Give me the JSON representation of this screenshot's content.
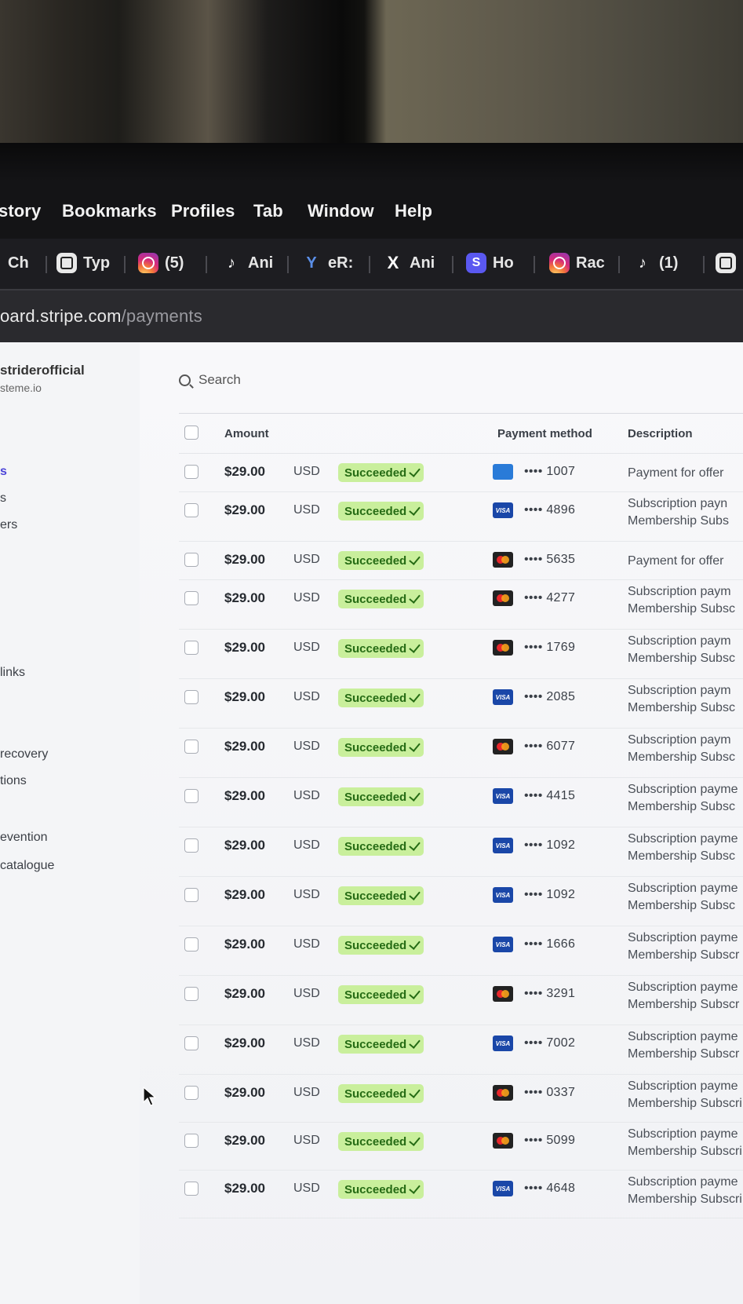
{
  "menubar": {
    "items": [
      "story",
      "Bookmarks",
      "Profiles",
      "Tab",
      "Window",
      "Help"
    ]
  },
  "tabs": [
    {
      "title": "Ch",
      "icon": "none"
    },
    {
      "title": "Typ",
      "icon": "square-app-icon"
    },
    {
      "title": "(5)",
      "icon": "instagram-icon"
    },
    {
      "title": "Ani",
      "icon": "tiktok-icon"
    },
    {
      "title": "eR:",
      "icon": "y-logo-icon"
    },
    {
      "title": "Ani",
      "icon": "x-logo-icon"
    },
    {
      "title": "Ho",
      "icon": "s-logo-icon"
    },
    {
      "title": "Rac",
      "icon": "instagram-icon"
    },
    {
      "title": "(1)",
      "icon": "tiktok-icon"
    }
  ],
  "address": {
    "host": "oard.stripe.com",
    "path": "/payments"
  },
  "sidebar": {
    "account_name": "striderofficial",
    "account_sub": "steme.io",
    "items": [
      "s",
      "s",
      "ers",
      "links",
      "recovery",
      "tions",
      "evention",
      "catalogue"
    ]
  },
  "search": {
    "placeholder": "Search"
  },
  "table": {
    "headers": {
      "amount": "Amount",
      "payment_method": "Payment method",
      "description": "Description"
    },
    "rows": [
      {
        "amount": "$29.00",
        "currency": "USD",
        "status": "Succeeded",
        "brand": "amex",
        "last4": "•••• 1007",
        "desc1": "Payment for offer",
        "desc2": ""
      },
      {
        "amount": "$29.00",
        "currency": "USD",
        "status": "Succeeded",
        "brand": "visa",
        "last4": "•••• 4896",
        "desc1": "Subscription payn",
        "desc2": "Membership Subs"
      },
      {
        "amount": "$29.00",
        "currency": "USD",
        "status": "Succeeded",
        "brand": "mastercard",
        "last4": "•••• 5635",
        "desc1": "Payment for offer",
        "desc2": ""
      },
      {
        "amount": "$29.00",
        "currency": "USD",
        "status": "Succeeded",
        "brand": "mastercard",
        "last4": "•••• 4277",
        "desc1": "Subscription paym",
        "desc2": "Membership Subsc"
      },
      {
        "amount": "$29.00",
        "currency": "USD",
        "status": "Succeeded",
        "brand": "mastercard",
        "last4": "•••• 1769",
        "desc1": "Subscription paym",
        "desc2": "Membership Subsc"
      },
      {
        "amount": "$29.00",
        "currency": "USD",
        "status": "Succeeded",
        "brand": "visa",
        "last4": "•••• 2085",
        "desc1": "Subscription paym",
        "desc2": "Membership Subsc"
      },
      {
        "amount": "$29.00",
        "currency": "USD",
        "status": "Succeeded",
        "brand": "mastercard",
        "last4": "•••• 6077",
        "desc1": "Subscription paym",
        "desc2": "Membership Subsc"
      },
      {
        "amount": "$29.00",
        "currency": "USD",
        "status": "Succeeded",
        "brand": "visa",
        "last4": "•••• 4415",
        "desc1": "Subscription payme",
        "desc2": "Membership Subsc"
      },
      {
        "amount": "$29.00",
        "currency": "USD",
        "status": "Succeeded",
        "brand": "visa",
        "last4": "•••• 1092",
        "desc1": "Subscription payme",
        "desc2": "Membership Subsc"
      },
      {
        "amount": "$29.00",
        "currency": "USD",
        "status": "Succeeded",
        "brand": "visa",
        "last4": "•••• 1092",
        "desc1": "Subscription payme",
        "desc2": "Membership Subsc"
      },
      {
        "amount": "$29.00",
        "currency": "USD",
        "status": "Succeeded",
        "brand": "visa",
        "last4": "•••• 1666",
        "desc1": "Subscription payme",
        "desc2": "Membership Subscr"
      },
      {
        "amount": "$29.00",
        "currency": "USD",
        "status": "Succeeded",
        "brand": "mastercard",
        "last4": "•••• 3291",
        "desc1": "Subscription payme",
        "desc2": "Membership Subscr"
      },
      {
        "amount": "$29.00",
        "currency": "USD",
        "status": "Succeeded",
        "brand": "visa",
        "last4": "•••• 7002",
        "desc1": "Subscription payme",
        "desc2": "Membership Subscr"
      },
      {
        "amount": "$29.00",
        "currency": "USD",
        "status": "Succeeded",
        "brand": "mastercard",
        "last4": "•••• 0337",
        "desc1": "Subscription payme",
        "desc2": "Membership Subscri"
      },
      {
        "amount": "$29.00",
        "currency": "USD",
        "status": "Succeeded",
        "brand": "mastercard",
        "last4": "•••• 5099",
        "desc1": "Subscription payme",
        "desc2": "Membership Subscri"
      },
      {
        "amount": "$29.00",
        "currency": "USD",
        "status": "Succeeded",
        "brand": "visa",
        "last4": "•••• 4648",
        "desc1": "Subscription payme",
        "desc2": "Membership Subscri"
      }
    ]
  },
  "colors": {
    "status_bg": "#c9ef9c",
    "status_text": "#256b14",
    "nav_active": "#4b44d8"
  }
}
